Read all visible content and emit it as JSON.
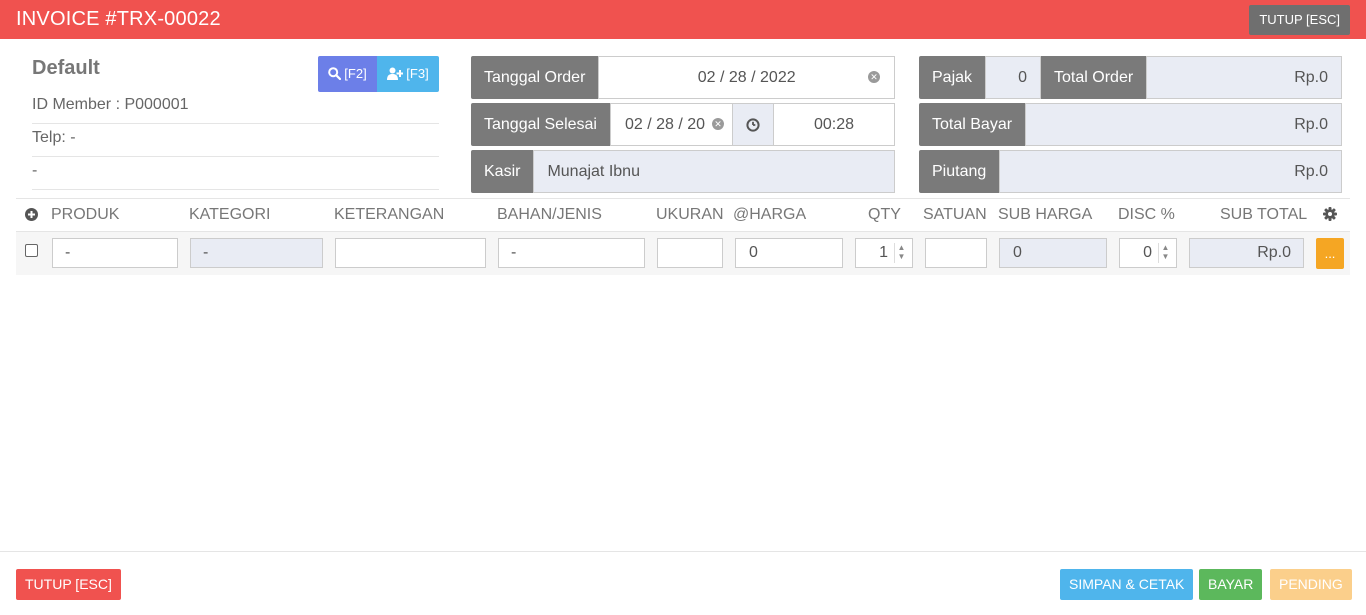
{
  "header": {
    "title": "INVOICE #TRX-00022",
    "close_label": "TUTUP [ESC]"
  },
  "customer": {
    "name": "Default",
    "search_label": "[F2]",
    "add_label": "[F3]",
    "member_id": "ID Member : P000001",
    "phone": "Telp: -",
    "address": "-"
  },
  "order": {
    "order_date_label": "Tanggal Order",
    "order_date_value": "02 / 28 / 2022",
    "finish_date_label": "Tanggal Selesai",
    "finish_date_value": "02 / 28 / 20",
    "finish_time_value": "00:28",
    "cashier_label": "Kasir",
    "cashier_value": "Munajat Ibnu"
  },
  "totals": {
    "tax_label": "Pajak",
    "tax_value": "0",
    "total_order_label": "Total Order",
    "total_order_value": "Rp.0",
    "total_paid_label": "Total Bayar",
    "total_paid_value": "Rp.0",
    "debt_label": "Piutang",
    "debt_value": "Rp.0"
  },
  "table": {
    "columns": [
      "PRODUK",
      "KATEGORI",
      "KETERANGAN",
      "BAHAN/JENIS",
      "UKURAN",
      "@HARGA",
      "QTY",
      "SATUAN",
      "SUB HARGA",
      "DISC %",
      "SUB TOTAL"
    ],
    "rows": [
      {
        "produk": "-",
        "kategori": "-",
        "keterangan": "",
        "bahan": "-",
        "ukuran": "",
        "harga": "0",
        "qty": "1",
        "satuan": "",
        "sub_harga": "0",
        "disc": "0",
        "sub_total": "Rp.0",
        "action": "..."
      }
    ]
  },
  "footer": {
    "close_label": "TUTUP [ESC]",
    "save_print_label": "SIMPAN & CETAK",
    "pay_label": "BAYAR",
    "pending_label": "PENDING"
  },
  "colors": {
    "header_bg": "#f0524f",
    "label_bg": "#7a7a7a",
    "primary": "#6c7fe8",
    "info": "#4fb5ec",
    "success": "#5cb85c",
    "warning": "#f5a623"
  }
}
